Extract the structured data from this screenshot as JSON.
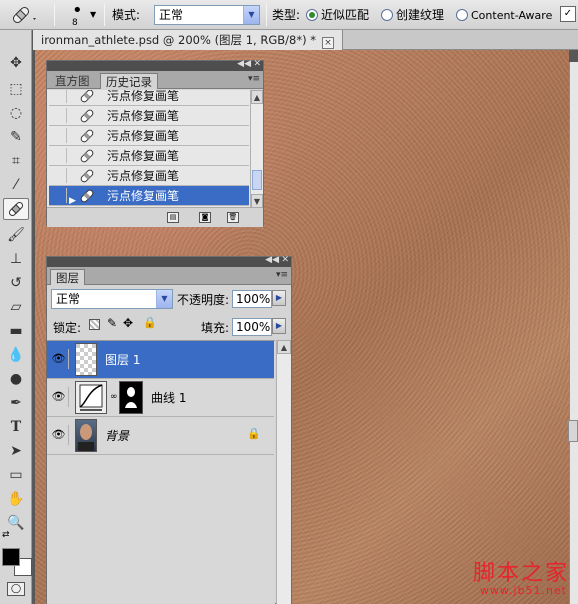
{
  "options_bar": {
    "brush_size": "8",
    "mode_label": "模式:",
    "mode_value": "正常",
    "type_label": "类型:",
    "type_options": [
      "近似匹配",
      "创建纹理",
      "Content-Aware"
    ],
    "type_selected": "近似匹配"
  },
  "document": {
    "tab_title": "ironman_athlete.psd @ 200% (图层 1, RGB/8*) *",
    "close_glyph": "×"
  },
  "history_panel": {
    "tabs": [
      "直方图",
      "历史记录"
    ],
    "active_tab": "历史记录",
    "items": [
      "污点修复画笔",
      "污点修复画笔",
      "污点修复画笔",
      "污点修复画笔",
      "污点修复画笔",
      "污点修复画笔"
    ]
  },
  "layers_panel": {
    "tab": "图层",
    "blend_mode": "正常",
    "opacity_label": "不透明度:",
    "opacity_value": "100%",
    "lock_label": "锁定:",
    "fill_label": "填充:",
    "fill_value": "100%",
    "layers": [
      {
        "name": "图层 1",
        "selected": true
      },
      {
        "name": "曲线 1",
        "selected": false
      },
      {
        "name": "背景",
        "selected": false
      }
    ]
  },
  "watermark": {
    "title": "脚本之家",
    "url": "www.jb51.net"
  },
  "colors": {
    "selection": "#3a6cc5",
    "skin": "#b87d5d"
  }
}
